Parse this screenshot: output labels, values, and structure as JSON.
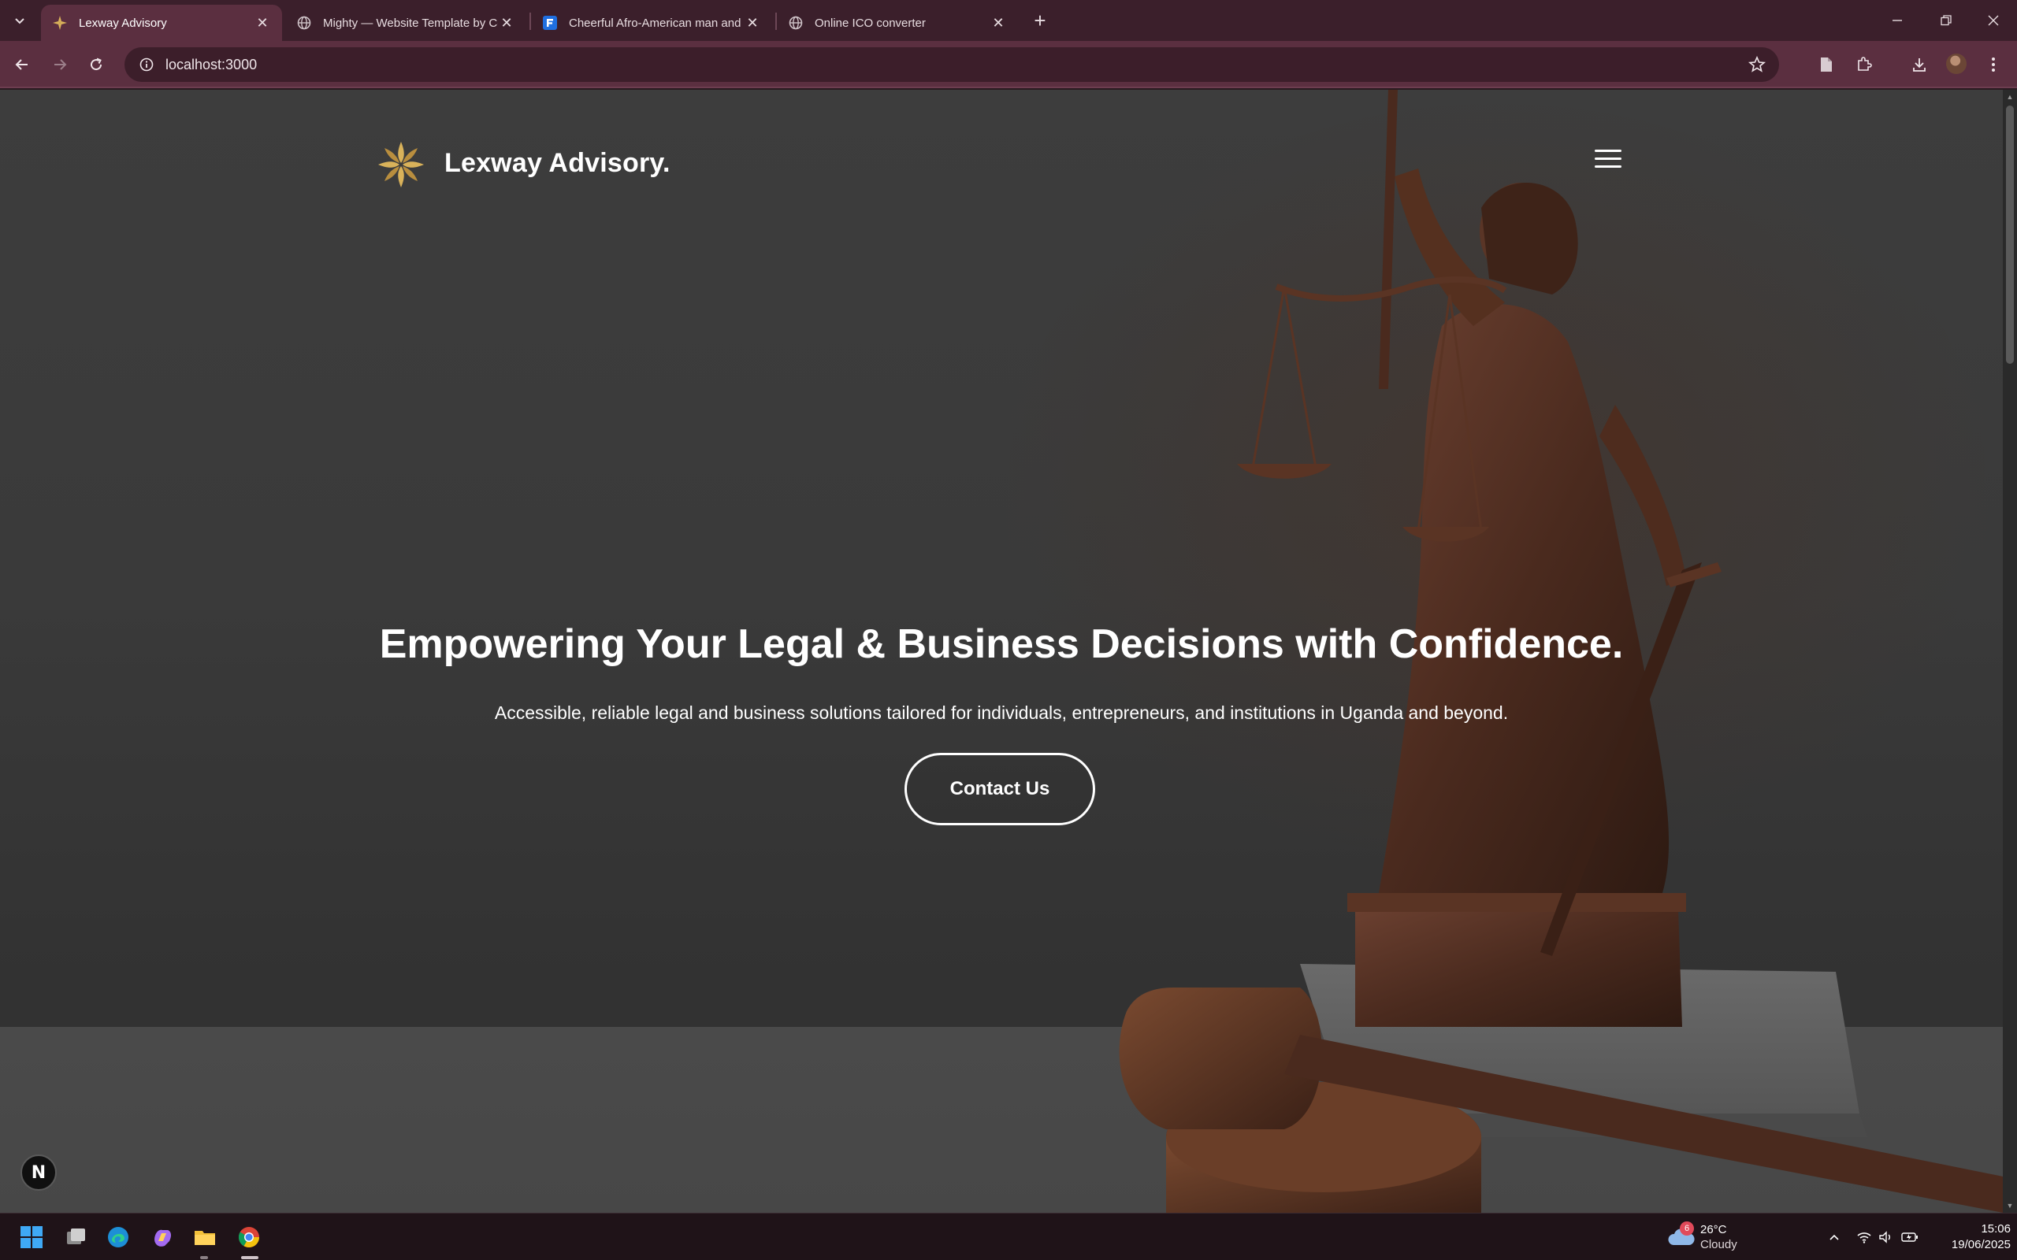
{
  "browser": {
    "tabs": [
      {
        "title": "Lexway Advisory",
        "active": true,
        "favicon": "lexway-logo-icon"
      },
      {
        "title": "Mighty — Website Template by Co",
        "active": false,
        "favicon": "globe-icon"
      },
      {
        "title": "Cheerful Afro-American man and w",
        "active": false,
        "favicon": "freepik-icon"
      },
      {
        "title": "Online ICO converter",
        "active": false,
        "favicon": "globe-icon"
      }
    ],
    "url": "localhost:3000"
  },
  "site": {
    "brand_name": "Lexway Advisory.",
    "hero": {
      "title": "Empowering Your Legal & Business Decisions with Confidence.",
      "subtitle": "Accessible, reliable legal and business solutions tailored for individuals, entrepreneurs, and institutions in Uganda and beyond.",
      "cta_label": "Contact Us"
    },
    "dev_badge": "N"
  },
  "taskbar": {
    "weather": {
      "temp": "26°C",
      "condition": "Cloudy",
      "badge": "6"
    },
    "time": "15:06",
    "date": "19/06/2025"
  },
  "colors": {
    "chrome_frame": "#3b1f2b",
    "chrome_toolbar": "#5b2f40",
    "gold": "#d9b25a",
    "bronze": "#5a3322"
  }
}
